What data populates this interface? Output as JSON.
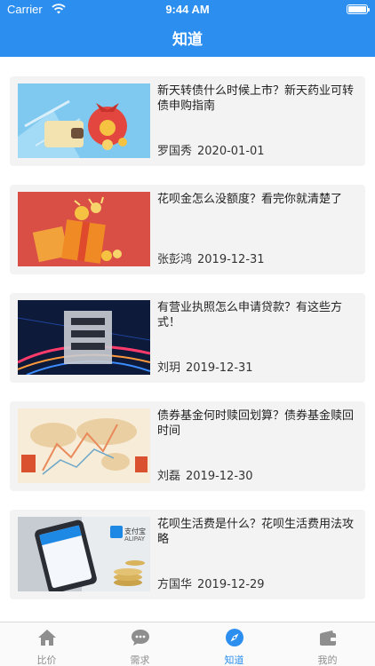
{
  "status_bar": {
    "carrier": "Carrier",
    "time": "9:44 AM"
  },
  "header": {
    "title": "知道"
  },
  "articles": [
    {
      "title": "新天转债什么时候上市？新天药业可转债申购指南",
      "author": "罗国秀",
      "date": "2020-01-01",
      "thumb_icon": "money-bag-wallet-icon"
    },
    {
      "title": "花呗金怎么没额度？看完你就清楚了",
      "author": "张彭鸿",
      "date": "2019-12-31",
      "thumb_icon": "gift-box-coins-icon"
    },
    {
      "title": "有营业执照怎么申请贷款？有这些方式！",
      "author": "刘玥",
      "date": "2019-12-31",
      "thumb_icon": "loan-character-icon"
    },
    {
      "title": "债券基金何时赎回划算？债券基金赎回时间",
      "author": "刘磊",
      "date": "2019-12-30",
      "thumb_icon": "world-map-chart-icon"
    },
    {
      "title": "花呗生活费是什么？花呗生活费用法攻略",
      "author": "方国华",
      "date": "2019-12-29",
      "thumb_icon": "phone-alipay-icon",
      "thumb_logo_text": "支付宝",
      "thumb_logo_sub": "ALIPAY"
    }
  ],
  "tabbar": {
    "active": 2,
    "tabs": [
      {
        "label": "比价",
        "icon": "home-icon"
      },
      {
        "label": "需求",
        "icon": "chat-bubble-icon"
      },
      {
        "label": "知道",
        "icon": "compass-icon"
      },
      {
        "label": "我的",
        "icon": "wallet-icon"
      }
    ]
  },
  "colors": {
    "primary": "#2c8ff0",
    "card_bg": "#f3f3f3",
    "tab_inactive": "#8e8e8e"
  }
}
